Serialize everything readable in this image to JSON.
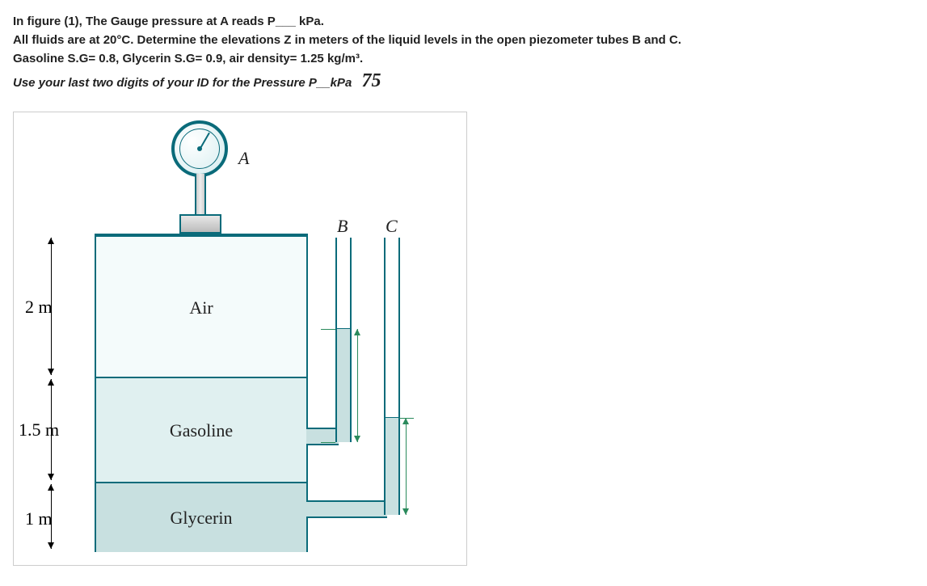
{
  "problem": {
    "line1_prefix": "In figure (1), The Gauge pressure at A reads P",
    "line1_blank": "___",
    "line1_suffix": " kPa.",
    "line2": "All fluids are at 20°C. Determine the elevations Z in meters of the liquid levels in the open piezometer tubes B and C.",
    "line3": "Gasoline S.G= 0.8, Glycerin S.G= 0.9, air density= 1.25 kg/m³.",
    "line4": "Use your last two digits of your ID for the Pressure P__kPa",
    "id_value": "75"
  },
  "figure": {
    "gauge_label": "A",
    "tube_b_label": "B",
    "tube_c_label": "C",
    "section_air": "Air",
    "section_gasoline": "Gasoline",
    "section_glycerin": "Glycerin",
    "dim_air": "2 m",
    "dim_gasoline": "1.5 m",
    "dim_glycerin": "1 m"
  },
  "chart_data": {
    "type": "table",
    "title": "Tank layer heights and fluid properties",
    "layers": [
      {
        "name": "Air",
        "height_m": 2,
        "density_kg_m3": 1.25
      },
      {
        "name": "Gasoline",
        "height_m": 1.5,
        "SG": 0.8
      },
      {
        "name": "Glycerin",
        "height_m": 1,
        "SG": 0.9
      }
    ],
    "gauge_pressure_kPa": 75,
    "piezometers": [
      "B",
      "C"
    ]
  }
}
